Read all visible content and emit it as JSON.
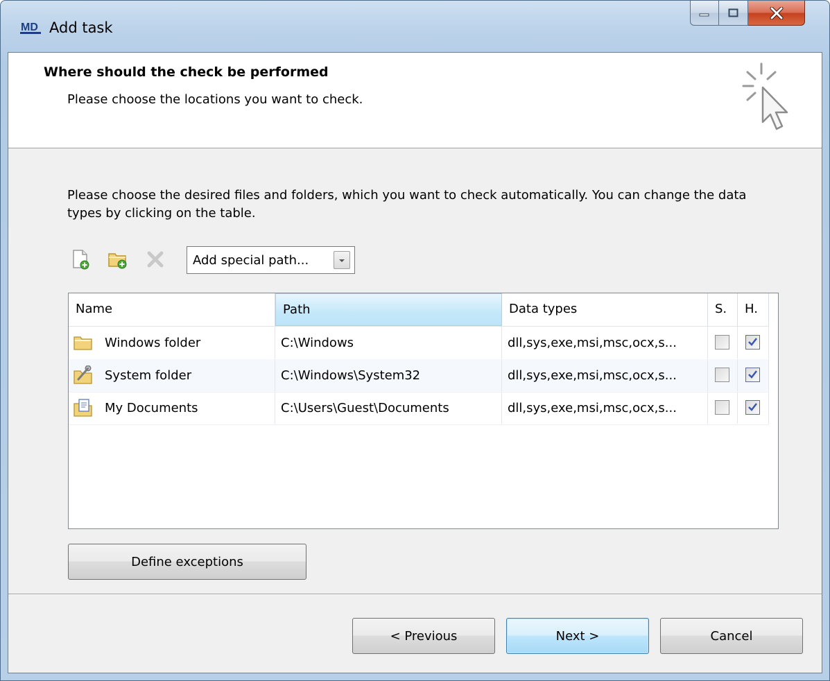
{
  "window": {
    "title": "Add task",
    "logo_text": "MD"
  },
  "header": {
    "title": "Where should the check be performed",
    "subtitle": "Please choose the locations you want to check."
  },
  "description": "Please choose the desired files and folders, which you want to check automatically. You can change the data types by clicking on the table.",
  "toolbar": {
    "add_file_icon": "add-file-icon",
    "add_folder_icon": "add-folder-icon",
    "delete_icon": "delete-icon",
    "special_path_value": "Add special path..."
  },
  "table": {
    "columns": [
      "Name",
      "Path",
      "Data types",
      "S.",
      "H."
    ],
    "rows": [
      {
        "icon": "folder-icon",
        "name": "Windows folder",
        "path": "C:\\Windows",
        "data_types": "dll,sys,exe,msi,msc,ocx,s...",
        "s": false,
        "h": true
      },
      {
        "icon": "system-folder-icon",
        "name": "System folder",
        "path": "C:\\Windows\\System32",
        "data_types": "dll,sys,exe,msi,msc,ocx,s...",
        "s": false,
        "h": true
      },
      {
        "icon": "documents-folder-icon",
        "name": "My Documents",
        "path": "C:\\Users\\Guest\\Documents",
        "data_types": "dll,sys,exe,msi,msc,ocx,s...",
        "s": false,
        "h": true
      }
    ]
  },
  "buttons": {
    "define_exceptions": "Define exceptions",
    "previous": "< Previous",
    "next": "Next >",
    "cancel": "Cancel"
  },
  "colors": {
    "window_frame": "#b7cfe7",
    "client_bg": "#f0f0f0",
    "active_header": "#c4e8fa",
    "checkbox_check": "#3a58b0"
  }
}
